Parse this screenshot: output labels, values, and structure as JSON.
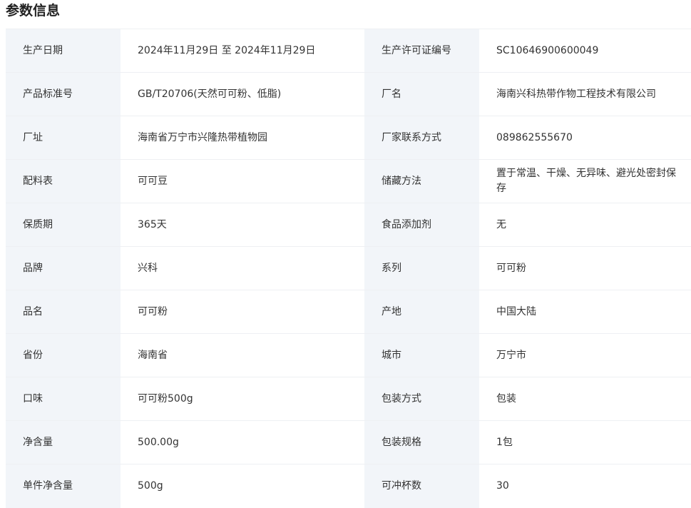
{
  "section": {
    "title": "参数信息"
  },
  "rows": [
    {
      "label1": "生产日期",
      "value1": "2024年11月29日 至 2024年11月29日",
      "label2": "生产许可证编号",
      "value2": "SC10646900600049"
    },
    {
      "label1": "产品标准号",
      "value1": "GB/T20706(天然可可粉、低脂)",
      "label2": "厂名",
      "value2": "海南兴科热带作物工程技术有限公司"
    },
    {
      "label1": "厂址",
      "value1": "海南省万宁市兴隆热带植物园",
      "label2": "厂家联系方式",
      "value2": "089862555670"
    },
    {
      "label1": "配料表",
      "value1": "可可豆",
      "label2": "储藏方法",
      "value2": "置于常温、干燥、无异味、避光处密封保存"
    },
    {
      "label1": "保质期",
      "value1": "365天",
      "label2": "食品添加剂",
      "value2": "无"
    },
    {
      "label1": "品牌",
      "value1": "兴科",
      "label2": "系列",
      "value2": "可可粉"
    },
    {
      "label1": "品名",
      "value1": "可可粉",
      "label2": "产地",
      "value2": "中国大陆"
    },
    {
      "label1": "省份",
      "value1": "海南省",
      "label2": "城市",
      "value2": "万宁市"
    },
    {
      "label1": "口味",
      "value1": "可可粉500g",
      "label2": "包装方式",
      "value2": "包装"
    },
    {
      "label1": "净含量",
      "value1": "500.00g",
      "label2": "包装规格",
      "value2": "1包"
    },
    {
      "label1": "单件净含量",
      "value1": "500g",
      "label2": "可冲杯数",
      "value2": "30"
    }
  ]
}
